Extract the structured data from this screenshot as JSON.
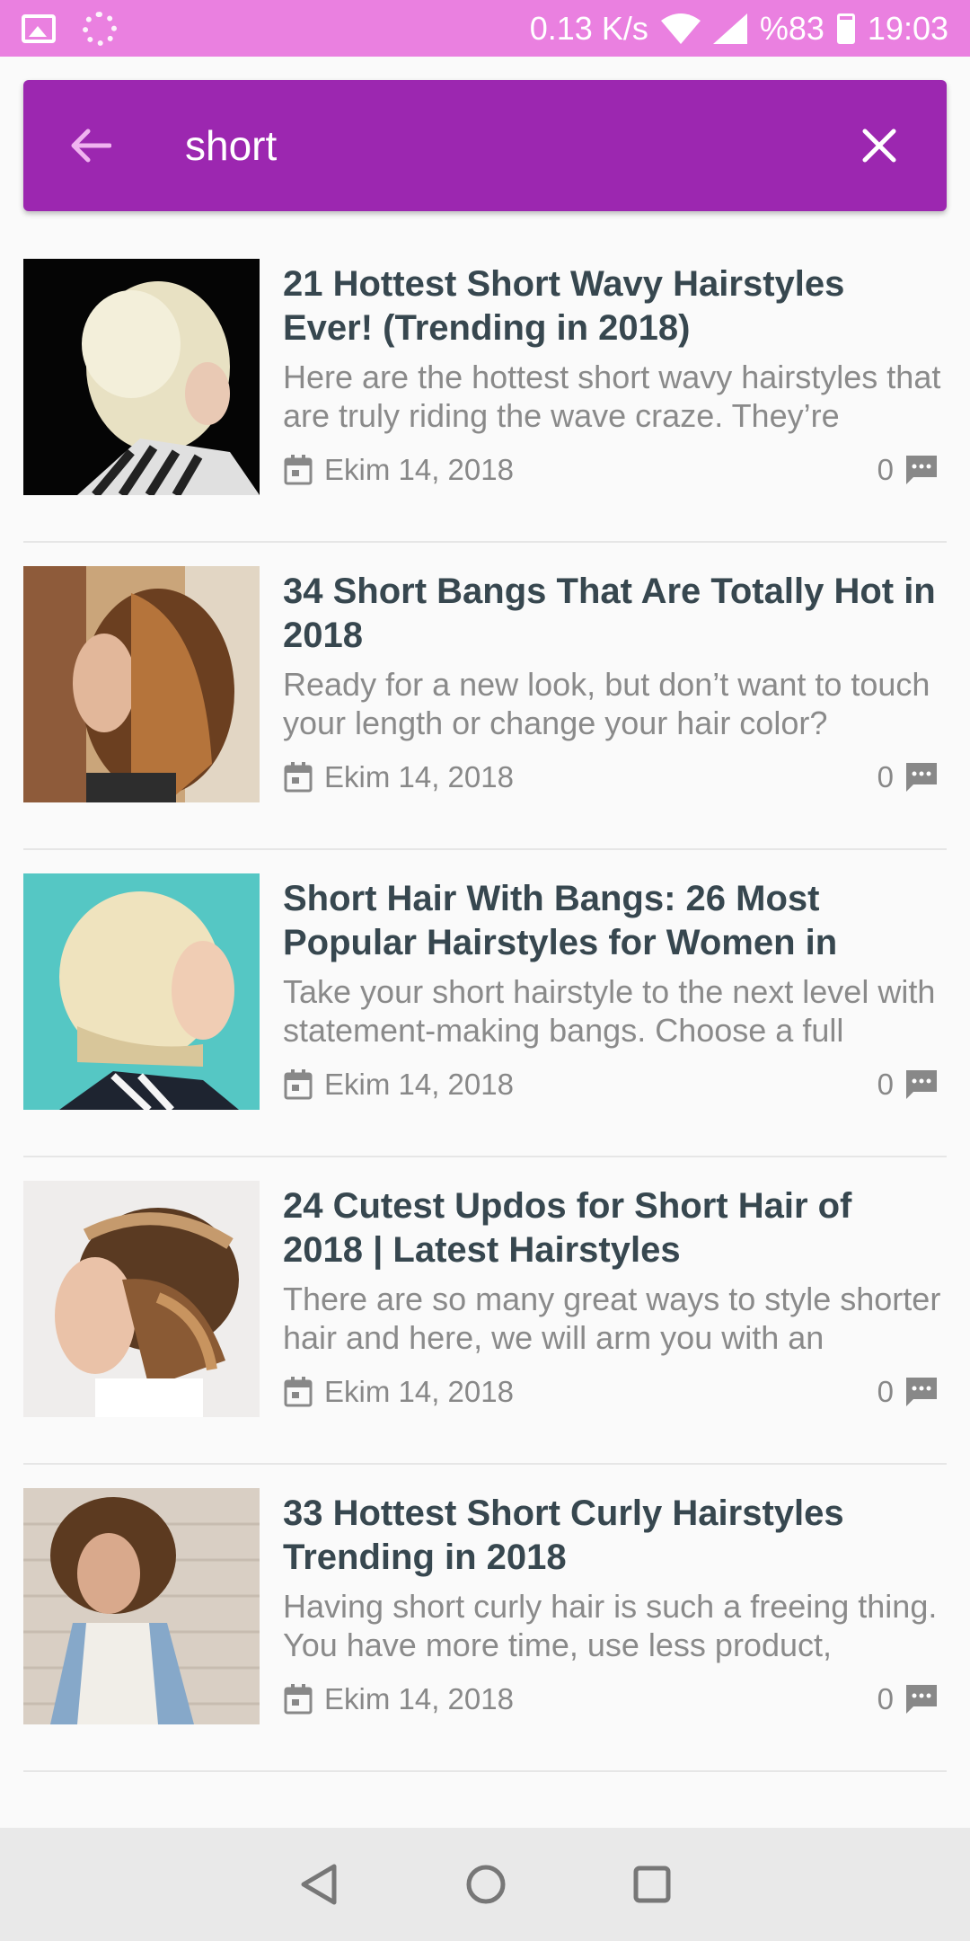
{
  "status_bar": {
    "speed": "0.13 K/s",
    "battery": "%83",
    "time": "19:03"
  },
  "search": {
    "query": "short"
  },
  "colors": {
    "status_bar": "#ea80e0",
    "toolbar": "#9c27b0",
    "title": "#37474f",
    "excerpt": "#8a8a8a"
  },
  "results": [
    {
      "title": "21 Hottest Short Wavy Hairstyles Ever! (Trending in 2018)",
      "excerpt": "Here are the hottest short wavy hairstyles that are truly riding the wave craze. They’re",
      "date": "Ekim 14, 2018",
      "comments": "0"
    },
    {
      "title": "34 Short Bangs That Are Totally Hot in 2018",
      "excerpt": "Ready for a new look, but don’t want to touch your length or change your hair color?",
      "date": "Ekim 14, 2018",
      "comments": "0"
    },
    {
      "title": "Short Hair With Bangs: 26 Most Popular Hairstyles for Women in",
      "excerpt": "Take your short hairstyle to the next level with statement-making bangs. Choose a full",
      "date": "Ekim 14, 2018",
      "comments": "0"
    },
    {
      "title": "24 Cutest Updos for Short Hair of 2018 | Latest Hairstyles",
      "excerpt": "There are so many great ways to style shorter hair and here, we will arm you with an",
      "date": "Ekim 14, 2018",
      "comments": "0"
    },
    {
      "title": "33 Hottest Short Curly Hairstyles Trending in 2018",
      "excerpt": "Having short curly hair is such a freeing thing. You have more time, use less product,",
      "date": "Ekim 14, 2018",
      "comments": "0"
    }
  ]
}
